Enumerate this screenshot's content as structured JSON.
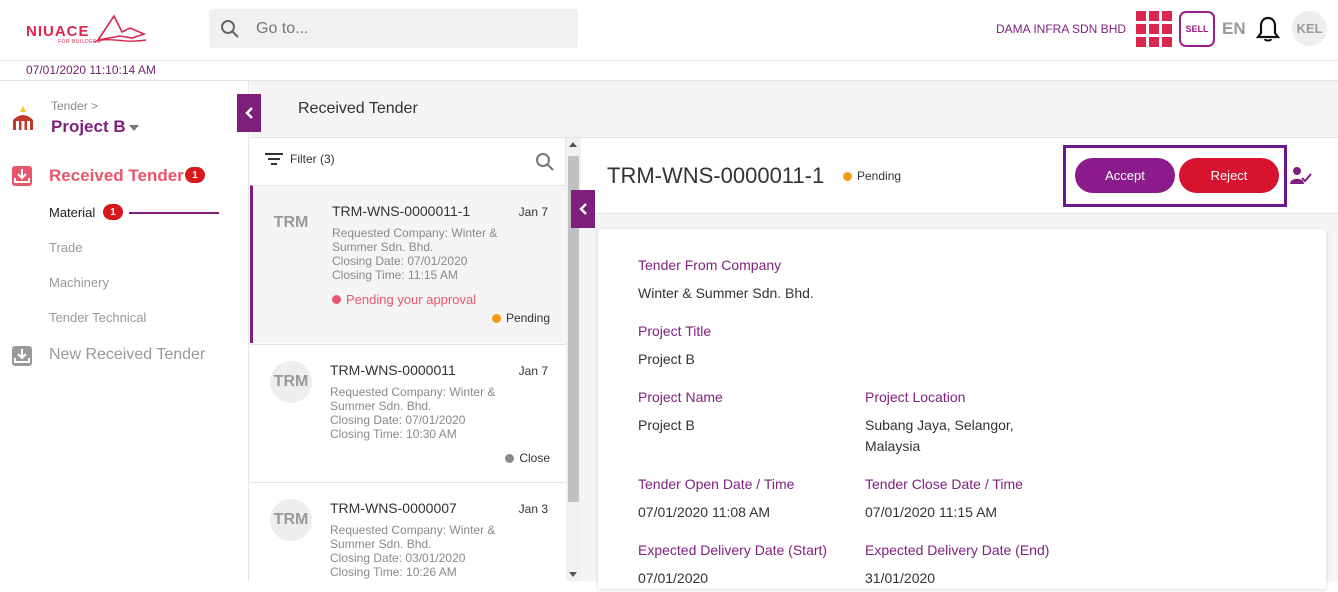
{
  "header": {
    "logo_text": "NIUACE",
    "logo_sub": "FOR BUILDERS",
    "search_placeholder": "Go to...",
    "company": "DAMA INFRA SDN BHD",
    "sell_label": "SELL",
    "language": "EN",
    "user_initials": "KEL",
    "datetime": "07/01/2020 11:10:14 AM"
  },
  "sidebar": {
    "breadcrumb": "Tender >",
    "project": "Project B",
    "received_tender": {
      "label": "Received Tender",
      "count": "1"
    },
    "sub_items": [
      {
        "label": "Material",
        "count": "1"
      },
      {
        "label": "Trade"
      },
      {
        "label": "Machinery"
      },
      {
        "label": "Tender Technical"
      }
    ],
    "new_received_tender": "New Received Tender"
  },
  "page": {
    "title": "Received Tender"
  },
  "list": {
    "filter_label": "Filter (3)",
    "items": [
      {
        "avatar": "TRM",
        "title": "TRM-WNS-0000011-1",
        "date": "Jan 7",
        "company": "Requested Company: Winter & Summer Sdn. Bhd.",
        "closing_date": "Closing Date: 07/01/2020",
        "closing_time": "Closing Time: 11:15 AM",
        "warning": "Pending your approval",
        "status": "Pending"
      },
      {
        "avatar": "TRM",
        "title": "TRM-WNS-0000011",
        "date": "Jan 7",
        "company": "Requested Company: Winter & Summer Sdn. Bhd.",
        "closing_date": "Closing Date: 07/01/2020",
        "closing_time": "Closing Time: 10:30 AM",
        "status": "Close"
      },
      {
        "avatar": "TRM",
        "title": "TRM-WNS-0000007",
        "date": "Jan 3",
        "company": "Requested Company: Winter & Summer Sdn. Bhd.",
        "closing_date": "Closing Date: 03/01/2020",
        "closing_time": "Closing Time: 10:26 AM"
      }
    ]
  },
  "detail": {
    "title": "TRM-WNS-0000011-1",
    "status": "Pending",
    "accept_label": "Accept",
    "reject_label": "Reject",
    "fields": {
      "tender_from_company": {
        "label": "Tender From Company",
        "value": "Winter & Summer Sdn. Bhd."
      },
      "project_title": {
        "label": "Project Title",
        "value": "Project B"
      },
      "project_name": {
        "label": "Project Name",
        "value": "Project B"
      },
      "project_location": {
        "label": "Project Location",
        "value": "Subang Jaya, Selangor, Malaysia"
      },
      "tender_open": {
        "label": "Tender Open Date / Time",
        "value": "07/01/2020 11:08 AM"
      },
      "tender_close": {
        "label": "Tender Close Date / Time",
        "value": "07/01/2020 11:15 AM"
      },
      "delivery_start": {
        "label": "Expected Delivery Date (Start)",
        "value": "07/01/2020"
      },
      "delivery_end": {
        "label": "Expected Delivery Date (End)",
        "value": "31/01/2020"
      }
    }
  },
  "colors": {
    "brand_purple": "#7e1f7e",
    "brand_pink": "#d9274f",
    "accept": "#8b1a8b",
    "reject": "#d7132f",
    "pending": "#f39c12",
    "close": "#8a8a8a",
    "badge": "#d7191f"
  },
  "icons": [
    "search-icon",
    "grid-icon",
    "bell-icon",
    "filter-icon",
    "chevron-left-icon",
    "inbox-icon",
    "user-check-icon",
    "project-icon"
  ]
}
